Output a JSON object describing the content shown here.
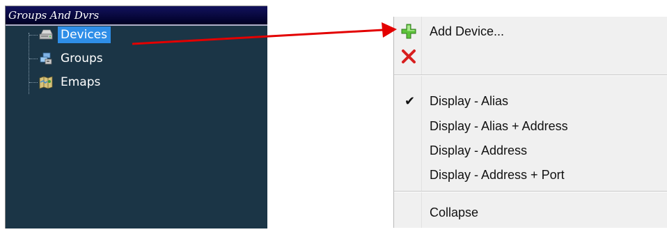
{
  "tree_panel": {
    "title": "Groups And Dvrs",
    "items": [
      {
        "label": "Devices",
        "icon": "devices-icon",
        "selected": true
      },
      {
        "label": "Groups",
        "icon": "groups-icon",
        "selected": false
      },
      {
        "label": "Emaps",
        "icon": "emaps-icon",
        "selected": false
      }
    ]
  },
  "context_menu": {
    "items": [
      {
        "label": "Add Device...",
        "icon": "add-icon"
      },
      {
        "label": "",
        "icon": "delete-icon"
      },
      {
        "label": "Display - Alias",
        "checked": true
      },
      {
        "label": "Display - Alias + Address",
        "checked": false
      },
      {
        "label": "Display - Address",
        "checked": false
      },
      {
        "label": "Display - Address + Port",
        "checked": false
      },
      {
        "label": "Collapse"
      }
    ]
  },
  "colors": {
    "panel_background": "#1b3546",
    "header_background": "#12125c",
    "selection": "#2e8ee8",
    "arrow": "#e30000",
    "menu_background": "#f0f0f0"
  }
}
